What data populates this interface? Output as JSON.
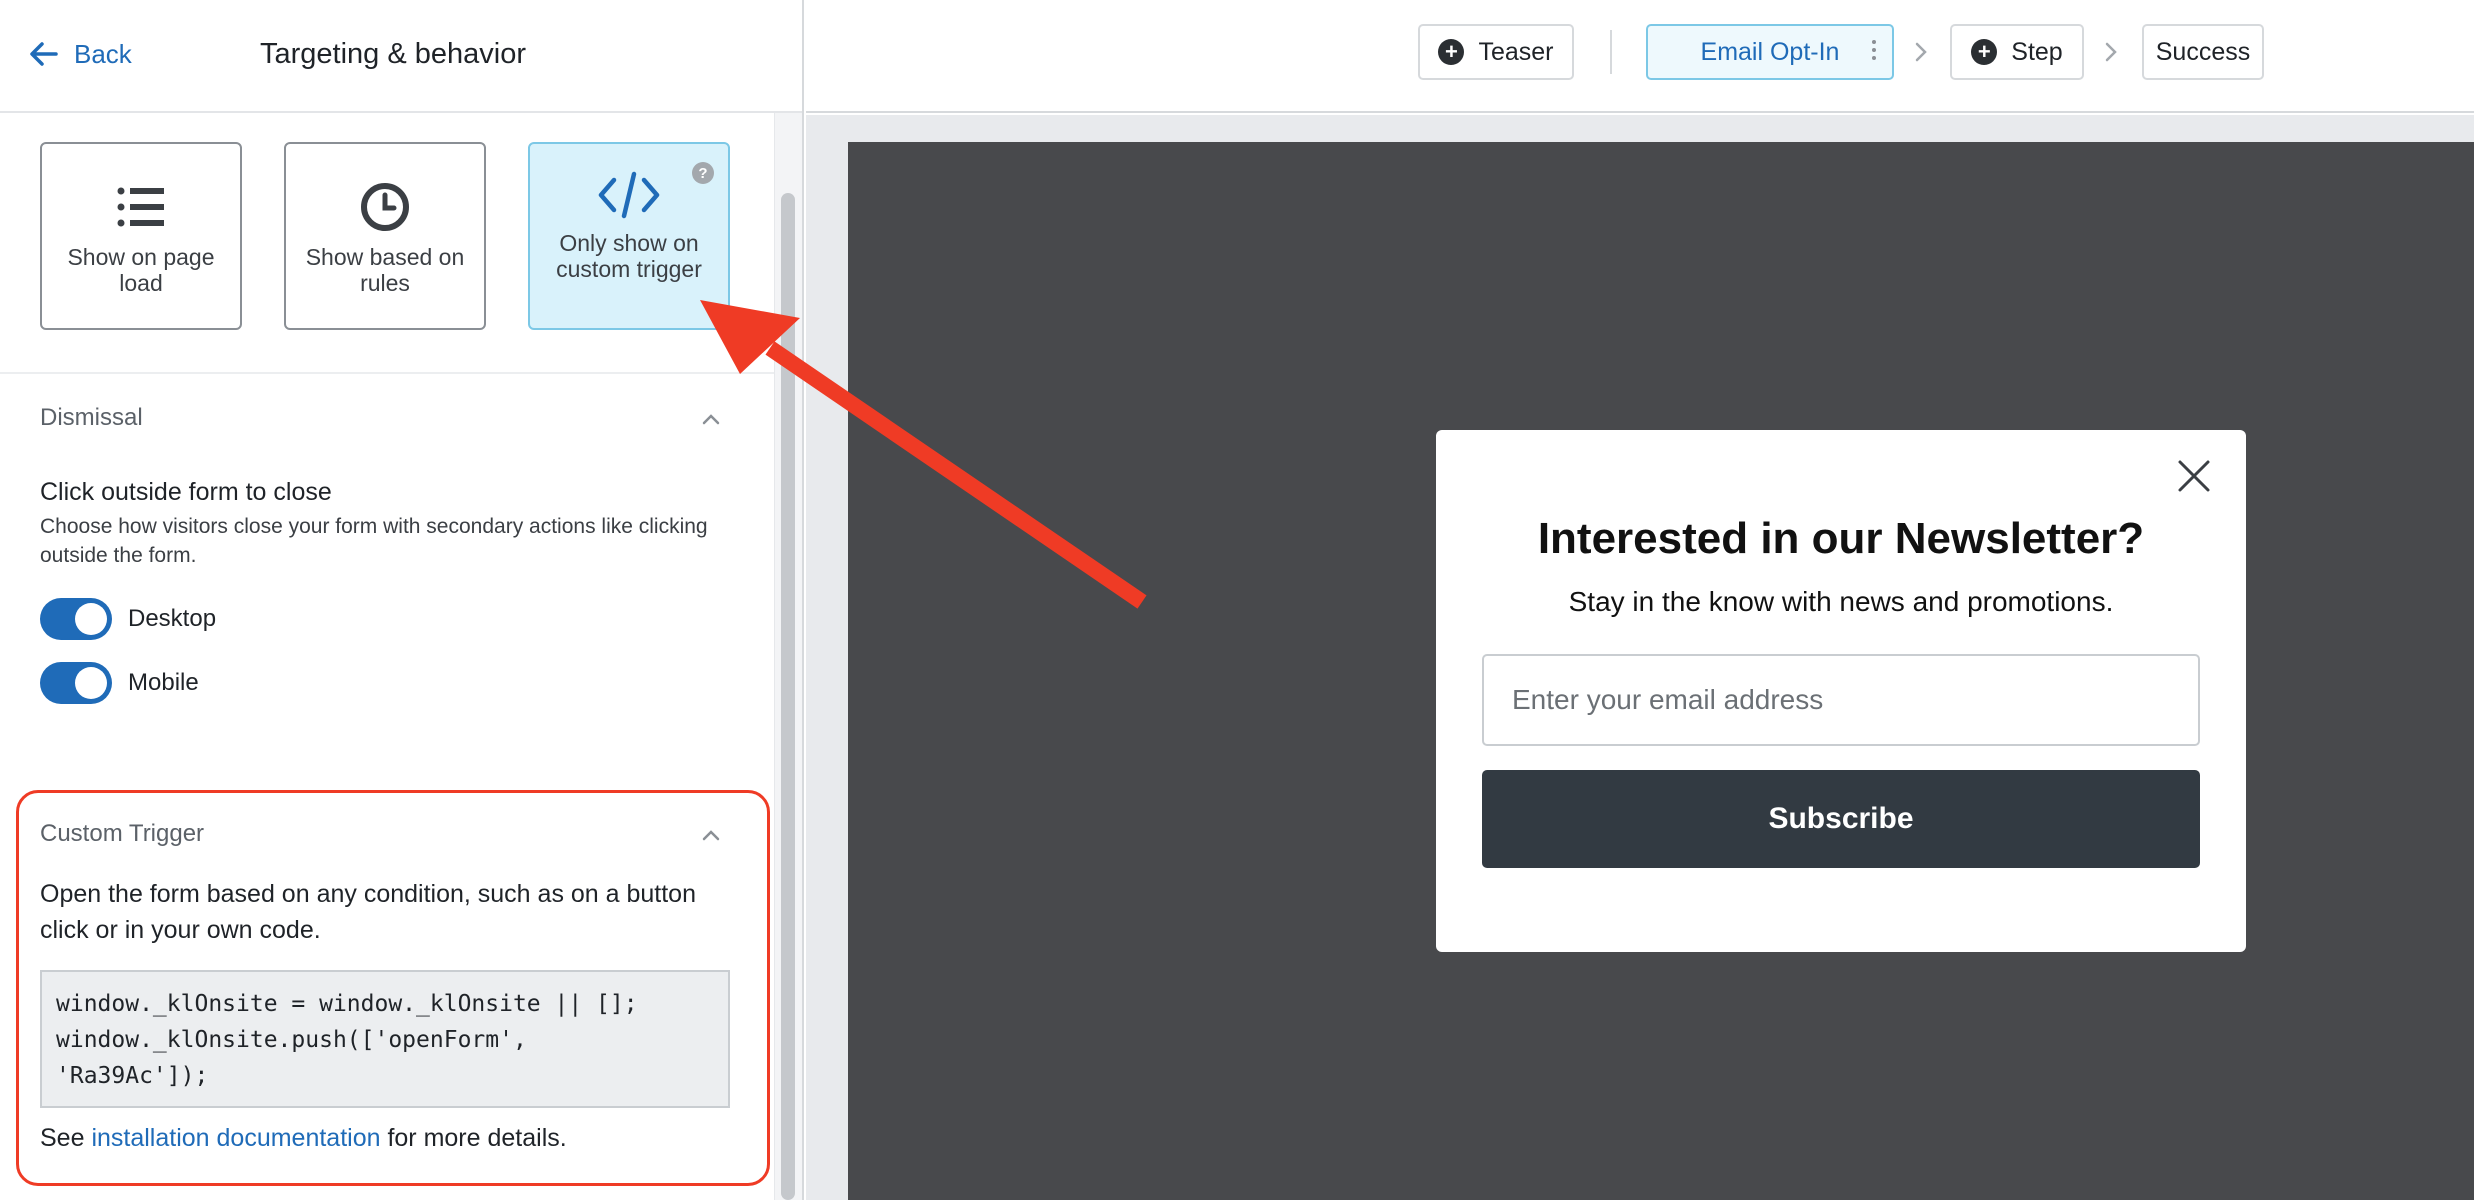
{
  "left_panel": {
    "back_label": "Back",
    "title": "Targeting & behavior",
    "trigger_options": [
      {
        "label": "Show on page load",
        "icon": "list-icon"
      },
      {
        "label": "Show based on rules",
        "icon": "clock-icon"
      },
      {
        "label": "Only show on custom trigger",
        "icon": "code-icon",
        "selected": true
      }
    ],
    "help_glyph": "?",
    "dismissal": {
      "section_label": "Dismissal",
      "title": "Click outside form to close",
      "description": "Choose how visitors close your form with secondary actions like clicking outside the form.",
      "toggles": [
        {
          "label": "Desktop",
          "on": true
        },
        {
          "label": "Mobile",
          "on": true
        }
      ]
    },
    "custom_trigger": {
      "section_label": "Custom Trigger",
      "description": "Open the form based on any condition, such as on a button click or in your own code.",
      "code": "window._klOnsite = window._klOnsite || [];\nwindow._klOnsite.push(['openForm',\n'Ra39Ac']);",
      "see_prefix": "See ",
      "doc_link": "installation documentation",
      "see_suffix": " for more details."
    }
  },
  "topbar": {
    "steps": [
      {
        "label": "Teaser",
        "icon": "plus-circle-icon"
      },
      {
        "label": "Email Opt-In",
        "active": true
      },
      {
        "label": "Step",
        "icon": "plus-circle-icon"
      },
      {
        "label": "Success"
      }
    ],
    "plus_glyph": "+"
  },
  "preview": {
    "modal_title": "Interested in our Newsletter?",
    "modal_subtitle": "Stay in the know with news and promotions.",
    "email_placeholder": "Enter your email address",
    "subscribe_label": "Subscribe"
  },
  "colors": {
    "accent": "#1f6bb8",
    "annotation": "#ef3b25",
    "canvas": "#48494c",
    "button_dark": "#323a42",
    "selected_card": "#d9f2fb"
  }
}
